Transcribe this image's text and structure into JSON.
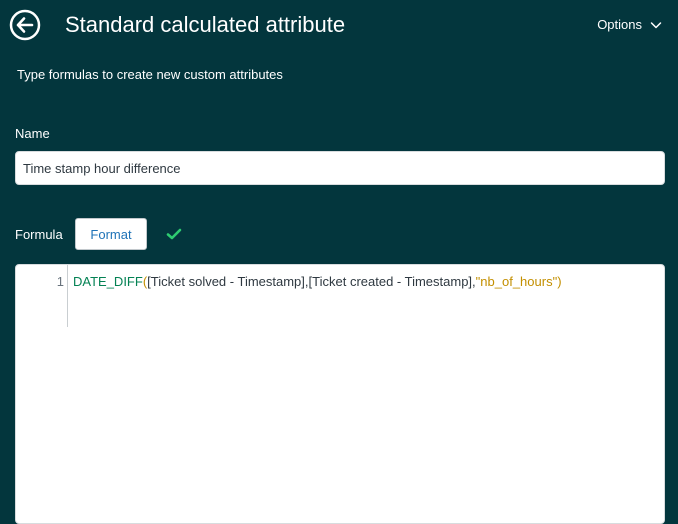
{
  "header": {
    "title": "Standard calculated attribute",
    "options_label": "Options"
  },
  "subtitle": "Type formulas to create new custom attributes",
  "name_field": {
    "label": "Name",
    "value": "Time stamp hour difference"
  },
  "formula": {
    "label": "Formula",
    "format_button": "Format",
    "status_icon": "check-icon",
    "status_color": "#2ecc71"
  },
  "editor": {
    "line_number": "1",
    "tokens": {
      "function": "DATE_DIFF",
      "open_paren": "(",
      "arg1": "[Ticket solved - Timestamp]",
      "comma1": ",",
      "arg2": "[Ticket created - Timestamp]",
      "comma2": ",",
      "arg3": "\"nb_of_hours\"",
      "close_paren": ")"
    }
  },
  "colors": {
    "background": "#03363d",
    "function": "#038153",
    "string": "#c38f00",
    "link": "#1f73b7"
  }
}
